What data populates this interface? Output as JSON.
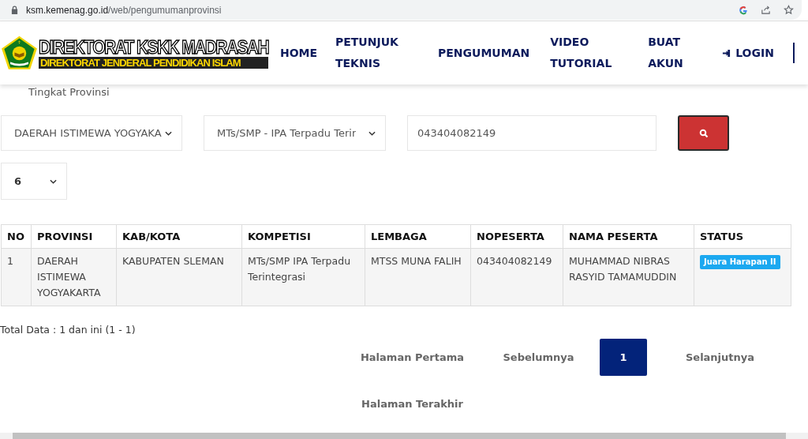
{
  "browser": {
    "url_host": "ksm.kemenag.go.id",
    "url_path": "/web/pengumumanprovinsi"
  },
  "header": {
    "logo_title": "DIREKTORAT KSKK MADRASAH",
    "logo_subtitle": "DIREKTORAT JENDERAL PENDIDIKAN ISLAM",
    "nav": [
      {
        "label": "HOME",
        "icon": false
      },
      {
        "label": "PETUNJUK TEKNIS",
        "icon": false
      },
      {
        "label": "PENGUMUMAN",
        "icon": false
      },
      {
        "label": "VIDEO TUTORIAL",
        "icon": false
      },
      {
        "label": "BUAT AKUN",
        "icon": false
      },
      {
        "label": "LOGIN",
        "icon": true
      }
    ]
  },
  "subtitle": "Tingkat Provinsi",
  "filters": {
    "province": "DAERAH ISTIMEWA YOGYAKA",
    "competition": "MTs/SMP - IPA Terpadu Terir",
    "participant_number": "043404082149",
    "page_size": "6"
  },
  "table": {
    "columns": [
      "NO",
      "PROVINSI",
      "KAB/KOTA",
      "KOMPETISI",
      "LEMBAGA",
      "NOPESERTA",
      "NAMA PESERTA",
      "STATUS"
    ],
    "rows": [
      {
        "cells": [
          "1",
          "DAERAH ISTIMEWA YOGYAKARTA",
          "KABUPATEN SLEMAN",
          "MTs/SMP IPA Terpadu Terintegrasi",
          "MTSS MUNA FALIH",
          "043404082149",
          "MUHAMMAD NIBRAS RASYID TAMAMUDDIN"
        ],
        "status": "Juara Harapan II"
      }
    ]
  },
  "total": "Total Data : 1 dan ini (1 - 1)",
  "pagination": [
    {
      "label": "Halaman Pertama",
      "selected": false
    },
    {
      "label": "Sebelumnya",
      "selected": false
    },
    {
      "label": "1",
      "selected": true
    },
    {
      "label": "Selanjutnya",
      "selected": false
    },
    {
      "label": "Halaman Terakhir",
      "selected": false
    }
  ]
}
